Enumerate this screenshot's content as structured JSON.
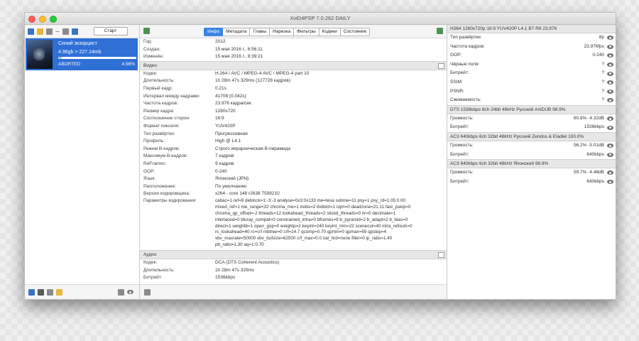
{
  "window": {
    "title": "XviD4PSP 7.0.262 DAILY"
  },
  "left": {
    "start_label": "Старт",
    "job": {
      "title": "Синий экзорцист",
      "size": "4.96gb > 227.14mb",
      "status": "ABORTED",
      "percent": "4.98%",
      "progress": 0.0498
    }
  },
  "center": {
    "tabs": [
      "Инфо",
      "Метадата",
      "Главы",
      "Нарезка",
      "Фильтры",
      "Кодеки",
      "Состояние"
    ],
    "active_tab": "Инфо",
    "general": [
      {
        "k": "Год:",
        "v": "2012"
      },
      {
        "k": "Создан:",
        "v": "15 мая 2016 г., 6:56:11"
      },
      {
        "k": "Изменён:",
        "v": "15 мая 2016 г., 8:39:21"
      }
    ],
    "video_title": "Видео",
    "video": [
      {
        "k": "Кодек:",
        "v": "H.264 / AVC / MPEG-4 AVC / MPEG-4 part 10"
      },
      {
        "k": "Длительность:",
        "v": "1h 28m 47s 329ms (127728 кадров)"
      },
      {
        "k": "Первый кадр:",
        "v": "0.21s"
      },
      {
        "k": "Интервал между кадрами:",
        "v": "41708 (0.042s)"
      },
      {
        "k": "Частота кадров:",
        "v": "23.976 кадра/сек"
      },
      {
        "k": "Размер кадра:",
        "v": "1280x720"
      },
      {
        "k": "Соотношение сторон:",
        "v": "16:9"
      },
      {
        "k": "Формат пикселя:",
        "v": "YUV420P"
      },
      {
        "k": "Тип развёртки:",
        "v": "Прогрессивная"
      },
      {
        "k": "Профиль:",
        "v": "High @ L4.1"
      },
      {
        "k": "Режим B-кадров:",
        "v": "Строго иерархическая B-пирамида"
      },
      {
        "k": "Максимум B-кадров:",
        "v": "7 кадров"
      },
      {
        "k": "ReFrames:",
        "v": "9 кадров"
      },
      {
        "k": "GOP:",
        "v": "0-240"
      },
      {
        "k": "Язык:",
        "v": "Японский (JPN)"
      },
      {
        "k": "Расположение:",
        "v": "По умолчанию"
      },
      {
        "k": "Версия кодировщика:",
        "v": "x264 - core 148 r2638 7599210"
      }
    ],
    "encoding_params_label": "Параметры кодирования:",
    "encoding_params": "cabac=1 ref=9 deblock=1:-3:-3 analyse=0x3:0x133 me=tesa subme=11 psy=1 psy_rd=1.05:0.00\nmixed_ref=1 me_range=32 chroma_me=1 trellis=2 8x8dct=1 cqm=0 deadzone=21,11 fast_pskip=0\nchroma_qp_offset=-2 threads=12 lookahead_threads=2 sliced_threads=0 nr=0 decimate=1\ninterlaced=0 bluray_compat=0 constrained_intra=0 bframes=9 b_pyramid=2 b_adapt=2 b_bias=0\ndirect=1 weightb=1 open_gop=0 weightp=2 keyint=240 keyint_min=22 scenecut=40 intra_refresh=0\nrc_lookahead=40 rc=crf mbtree=0 crf=14.7 qcomp=0.70 qpmin=0 qpmax=69 qpstep=4\nvbv_maxrate=50000 vbv_bufsize=62500 crf_max=0.0 nal_hrd=none filler=0 ip_ratio=1.40\npb_ratio=1.30 aq=1:0.70",
    "audio_title": "Аудио",
    "audio": [
      {
        "k": "Кодек:",
        "v": "DCA (DTS Coherent Acoustics)"
      },
      {
        "k": "Длительность:",
        "v": "1h 28m 47s 329ms"
      },
      {
        "k": "Битрейт:",
        "v": "1536kbps"
      }
    ]
  },
  "right": {
    "video_header": "H264 1280x720p 16:9 YUV420P L4.1 B7 R9 23.976",
    "video_rows": [
      {
        "k": "Тип развёртки:",
        "v": "8p"
      },
      {
        "k": "Частота кадров:",
        "v": "23.976fps"
      },
      {
        "k": "GOP:",
        "v": "0-240"
      },
      {
        "k": "Чёрные поля:",
        "v": "?"
      },
      {
        "k": "Битрейт:",
        "v": "?"
      },
      {
        "k": "SSIM:",
        "v": "?"
      },
      {
        "k": "PSNR:",
        "v": "?"
      },
      {
        "k": "Сжимаемость:",
        "v": "?"
      }
    ],
    "audio_tracks": [
      {
        "header": "DTS 1536kbps 6ch 24bit 48kHz Русский AniDUB 98.9%",
        "rows": [
          {
            "k": "Громкость:",
            "v": "60.8% -4.32dB"
          },
          {
            "k": "Битрейт:",
            "v": "1536kbps"
          }
        ]
      },
      {
        "header": "AC3 640kbps 6ch 32bit 48kHz Русский Zendos & Eladiel 100.0%",
        "rows": [
          {
            "k": "Громкость:",
            "v": "56.2% -5.01dB"
          },
          {
            "k": "Битрейт:",
            "v": "640kbps"
          }
        ]
      },
      {
        "header": "AC3 640kbps 6ch 32bit 48kHz Японский 98.9%",
        "rows": [
          {
            "k": "Громкость:",
            "v": "59.7% -4.48dB"
          },
          {
            "k": "Битрейт:",
            "v": "640kbps"
          }
        ]
      }
    ]
  }
}
